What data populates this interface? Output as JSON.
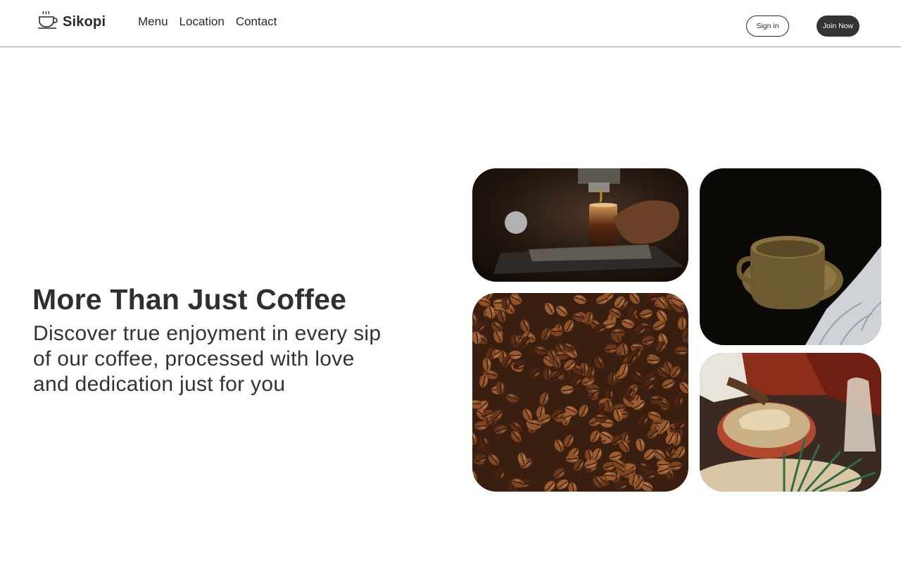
{
  "header": {
    "brand": "Sikopi",
    "brand_icon": "coffee-cup-icon",
    "nav": [
      "Menu",
      "Location",
      "Contact"
    ],
    "sign_in_label": "Sign in",
    "join_label": "Join Now"
  },
  "hero": {
    "title": "More Than Just Coffee",
    "subtitle": "Discover true enjoyment in every sip of our coffee, processed with love and dedication just for you"
  },
  "colors": {
    "text": "#2b2b2b",
    "join_button": "#333333",
    "divider": "#9a9a9a"
  }
}
